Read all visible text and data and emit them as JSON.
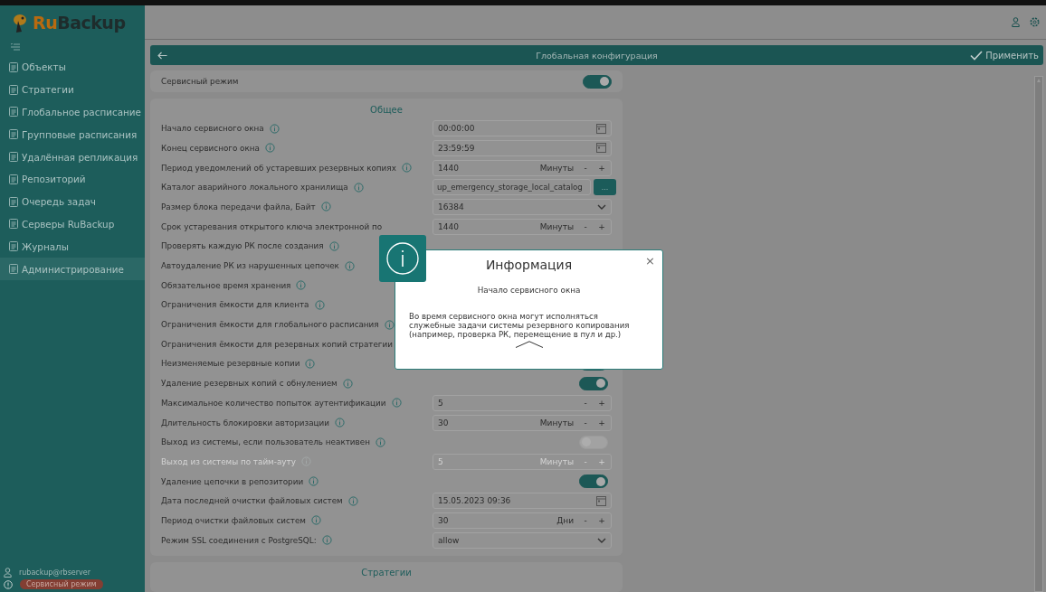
{
  "sidebar": {
    "logo": {
      "part_1": "Ru",
      "part_2": "Backup"
    },
    "items": [
      {
        "label": "Объекты",
        "selected": false
      },
      {
        "label": "Стратегии",
        "selected": false
      },
      {
        "label": "Глобальное расписание",
        "selected": false
      },
      {
        "label": "Групповые расписания",
        "selected": false
      },
      {
        "label": "Удалённая репликация",
        "selected": false
      },
      {
        "label": "Репозиторий",
        "selected": false
      },
      {
        "label": "Очередь задач",
        "selected": false
      },
      {
        "label": "Серверы RuBackup",
        "selected": false
      },
      {
        "label": "Журналы",
        "selected": false
      },
      {
        "label": "Администрирование",
        "selected": true
      }
    ],
    "user": "rubackup@rbserver",
    "mode_badge": "Сервисный режим"
  },
  "header": {
    "title": "Глобальная конфигурация",
    "apply_button": "Применить"
  },
  "service_mode": {
    "label": "Сервисный режим",
    "on": true
  },
  "general": {
    "title": "Общее",
    "rows": [
      {
        "label": "Начало сервисного окна",
        "info": true,
        "disabled": false,
        "kind": "time",
        "value": "00:00:00"
      },
      {
        "label": "Конец сервисного окна",
        "info": true,
        "disabled": false,
        "kind": "time",
        "value": "23:59:59"
      },
      {
        "label": "Период уведомлений об устаревших резервных копиях",
        "info": true,
        "disabled": false,
        "kind": "number",
        "value": "1440",
        "unit": "Минуты",
        "minus": "-",
        "plus": "+"
      },
      {
        "label": "Каталог аварийного локального хранилища",
        "info": true,
        "disabled": false,
        "kind": "path",
        "value": "up_emergency_storage_local_catalog",
        "button": "..."
      },
      {
        "label": "Размер блока передачи файла, Байт",
        "info": true,
        "disabled": false,
        "kind": "select",
        "value": "16384"
      },
      {
        "label": "Срок устаревания открытого ключа электронной по",
        "info": false,
        "disabled": false,
        "kind": "number",
        "value": "1440",
        "unit": "Минуты",
        "minus": "-",
        "plus": "+"
      },
      {
        "label": "Проверять каждую РК после создания",
        "info": true,
        "disabled": false,
        "kind": "hidden"
      },
      {
        "label": "Автоудаление РК из нарушенных цепочек",
        "info": true,
        "disabled": false,
        "kind": "hidden"
      },
      {
        "label": "Обязательное время хранения",
        "info": true,
        "disabled": false,
        "kind": "hidden"
      },
      {
        "label": "Ограничения ёмкости для клиента",
        "info": true,
        "disabled": false,
        "kind": "hidden"
      },
      {
        "label": "Ограничения ёмкости для глобального расписания",
        "info": true,
        "disabled": false,
        "kind": "hidden"
      },
      {
        "label": "Ограничения ёмкости для резервных копий стратегии",
        "info": false,
        "disabled": false,
        "kind": "hidden"
      },
      {
        "label": "Неизменяемые резервные копии",
        "info": true,
        "disabled": false,
        "kind": "toggle",
        "on": true
      },
      {
        "label": "Удаление резервных копий с обнулением",
        "info": true,
        "disabled": false,
        "kind": "toggle",
        "on": true
      },
      {
        "label": "Максимальное количество попыток аутентификации",
        "info": true,
        "disabled": false,
        "kind": "number",
        "value": "5",
        "minus": "-",
        "plus": "+"
      },
      {
        "label": "Длительность блокировки авторизации",
        "info": true,
        "disabled": false,
        "kind": "number",
        "value": "30",
        "unit": "Минуты",
        "minus": "-",
        "plus": "+"
      },
      {
        "label": "Выход из системы, если пользователь неактивен",
        "info": true,
        "disabled": false,
        "kind": "toggle",
        "on": false
      },
      {
        "label": "Выход из системы по тайм-ауту",
        "info": true,
        "disabled": true,
        "kind": "number",
        "value": "5",
        "unit": "Минуты",
        "minus": "-",
        "plus": "+"
      },
      {
        "label": "Удаление цепочки в репозитории",
        "info": true,
        "disabled": false,
        "kind": "toggle",
        "on": true
      },
      {
        "label": "Дата последней очистки файловых систем",
        "info": true,
        "disabled": false,
        "kind": "time",
        "value": "15.05.2023 09:36"
      },
      {
        "label": "Период очистки файловых систем",
        "info": true,
        "disabled": false,
        "kind": "number",
        "value": "30",
        "unit": "Дни",
        "minus": "-",
        "plus": "+"
      },
      {
        "label": "Режим SSL соединения с PostgreSQL:",
        "info": true,
        "disabled": false,
        "kind": "select",
        "value": "allow"
      }
    ]
  },
  "strategies": {
    "title": "Стратегии"
  },
  "dialog": {
    "title": "Информация",
    "close": "×",
    "subtitle": "Начало сервисного окна",
    "text": "Во время сервисного окна могут исполняться служебные задачи системы резервного копирования (например, проверка РК, перемещение в пул и др.)"
  }
}
